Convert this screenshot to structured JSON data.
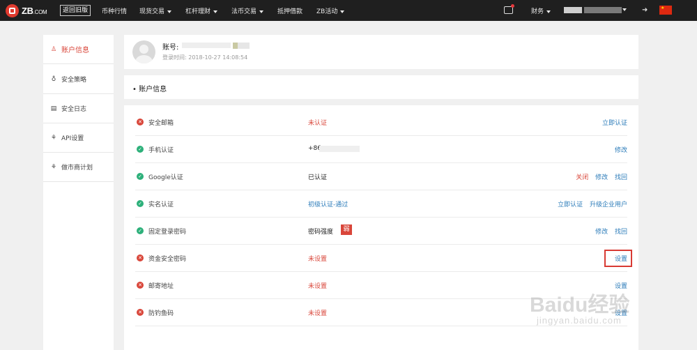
{
  "topbar": {
    "logo_text": "ZB",
    "logo_suffix": ".COM",
    "old_version": "返回旧版",
    "nav": [
      {
        "label": "币种行情",
        "dropdown": false
      },
      {
        "label": "现货交易",
        "dropdown": true
      },
      {
        "label": "杠杆理财",
        "dropdown": true
      },
      {
        "label": "法币交易",
        "dropdown": true
      },
      {
        "label": "抵押借款",
        "dropdown": false
      },
      {
        "label": "ZB活动",
        "dropdown": true
      }
    ],
    "finance": "财务",
    "icons": {
      "message": "message-icon",
      "logout": "logout-icon",
      "flag": "china-flag-icon"
    }
  },
  "sidebar": {
    "items": [
      {
        "label": "账户信息",
        "icon": "user-icon",
        "active": true
      },
      {
        "label": "安全策略",
        "icon": "bulb-icon",
        "active": false
      },
      {
        "label": "安全日志",
        "icon": "document-icon",
        "active": false
      },
      {
        "label": "API设置",
        "icon": "api-icon",
        "active": false
      },
      {
        "label": "做市商计划",
        "icon": "market-maker-icon",
        "active": false
      }
    ]
  },
  "account": {
    "label": "账号:",
    "login_time": "登录时间: 2018-10-27 14:08:54"
  },
  "section": {
    "title": "• 账户信息"
  },
  "rows": [
    {
      "name": "安全邮箱",
      "status": "no",
      "value": "未认证",
      "value_style": "red",
      "actions": [
        {
          "label": "立即认证",
          "style": "blue"
        }
      ]
    },
    {
      "name": "手机认证",
      "status": "ok",
      "value": "+86",
      "value_style": "plain",
      "actions": [
        {
          "label": "修改",
          "style": "blue"
        }
      ]
    },
    {
      "name": "Google认证",
      "status": "ok",
      "value": "已认证",
      "value_style": "plain",
      "actions": [
        {
          "label": "关闭",
          "style": "danger"
        },
        {
          "label": "修改",
          "style": "blue"
        },
        {
          "label": "找回",
          "style": "blue"
        }
      ]
    },
    {
      "name": "实名认证",
      "status": "ok",
      "value": "初级认证-通过",
      "value_style": "blue",
      "actions": [
        {
          "label": "立即认证",
          "style": "blue"
        },
        {
          "label": "升级企业用户",
          "style": "blue"
        }
      ]
    },
    {
      "name": "固定登录密码",
      "status": "ok",
      "value": "密码强度",
      "value_style": "plain",
      "badge": "弱",
      "actions": [
        {
          "label": "修改",
          "style": "blue"
        },
        {
          "label": "找回",
          "style": "blue"
        }
      ]
    },
    {
      "name": "资金安全密码",
      "status": "no",
      "value": "未设置",
      "value_style": "red",
      "actions": [
        {
          "label": "设置",
          "style": "blue"
        }
      ]
    },
    {
      "name": "邮寄地址",
      "status": "no",
      "value": "未设置",
      "value_style": "red",
      "actions": [
        {
          "label": "设置",
          "style": "blue"
        }
      ]
    },
    {
      "name": "防钓鱼码",
      "status": "no",
      "value": "未设置",
      "value_style": "red",
      "actions": [
        {
          "label": "设置",
          "style": "blue"
        }
      ]
    }
  ],
  "watermark": {
    "main": "Baidu经验",
    "sub": "jingyan.baidu.com"
  },
  "colors": {
    "accent_red": "#d9463a",
    "link_blue": "#2b7bb9",
    "ok_green": "#2db07a",
    "topbar": "#1f1f1f"
  }
}
